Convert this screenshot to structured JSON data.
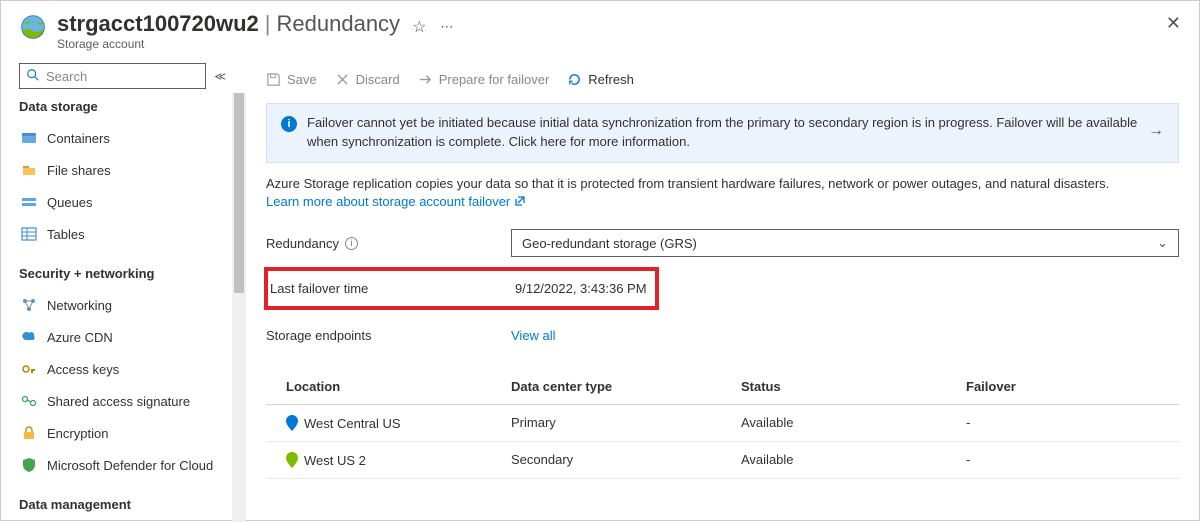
{
  "header": {
    "account_name": "strgacct100720wu2",
    "section": "Redundancy",
    "resource_type": "Storage account"
  },
  "sidebar": {
    "search_placeholder": "Search",
    "groups": [
      {
        "title": "Data storage",
        "items": [
          {
            "label": "Containers",
            "icon": "containers-icon"
          },
          {
            "label": "File shares",
            "icon": "file-shares-icon"
          },
          {
            "label": "Queues",
            "icon": "queues-icon"
          },
          {
            "label": "Tables",
            "icon": "tables-icon"
          }
        ]
      },
      {
        "title": "Security + networking",
        "items": [
          {
            "label": "Networking",
            "icon": "networking-icon"
          },
          {
            "label": "Azure CDN",
            "icon": "azure-cdn-icon"
          },
          {
            "label": "Access keys",
            "icon": "access-keys-icon"
          },
          {
            "label": "Shared access signature",
            "icon": "sas-icon"
          },
          {
            "label": "Encryption",
            "icon": "encryption-icon"
          },
          {
            "label": "Microsoft Defender for Cloud",
            "icon": "defender-icon"
          }
        ]
      },
      {
        "title": "Data management",
        "items": []
      }
    ]
  },
  "toolbar": {
    "save": "Save",
    "discard": "Discard",
    "prepare": "Prepare for failover",
    "refresh": "Refresh"
  },
  "banner": {
    "text": "Failover cannot yet be initiated because initial data synchronization from the primary to secondary region is in progress. Failover will be available when synchronization is complete. Click here for more information."
  },
  "description": {
    "text": "Azure Storage replication copies your data so that it is protected from transient hardware failures, network or power outages, and natural disasters.",
    "link": "Learn more about storage account failover"
  },
  "fields": {
    "redundancy_label": "Redundancy",
    "redundancy_value": "Geo-redundant storage (GRS)",
    "last_failover_label": "Last failover time",
    "last_failover_value": "9/12/2022, 3:43:36 PM",
    "endpoints_label": "Storage endpoints",
    "endpoints_link": "View all"
  },
  "table": {
    "headers": {
      "location": "Location",
      "dc": "Data center type",
      "status": "Status",
      "failover": "Failover"
    },
    "rows": [
      {
        "location": "West Central US",
        "dc": "Primary",
        "status": "Available",
        "failover": "-",
        "pin": "#0078d4"
      },
      {
        "location": "West US 2",
        "dc": "Secondary",
        "status": "Available",
        "failover": "-",
        "pin": "#7fba00"
      }
    ]
  }
}
